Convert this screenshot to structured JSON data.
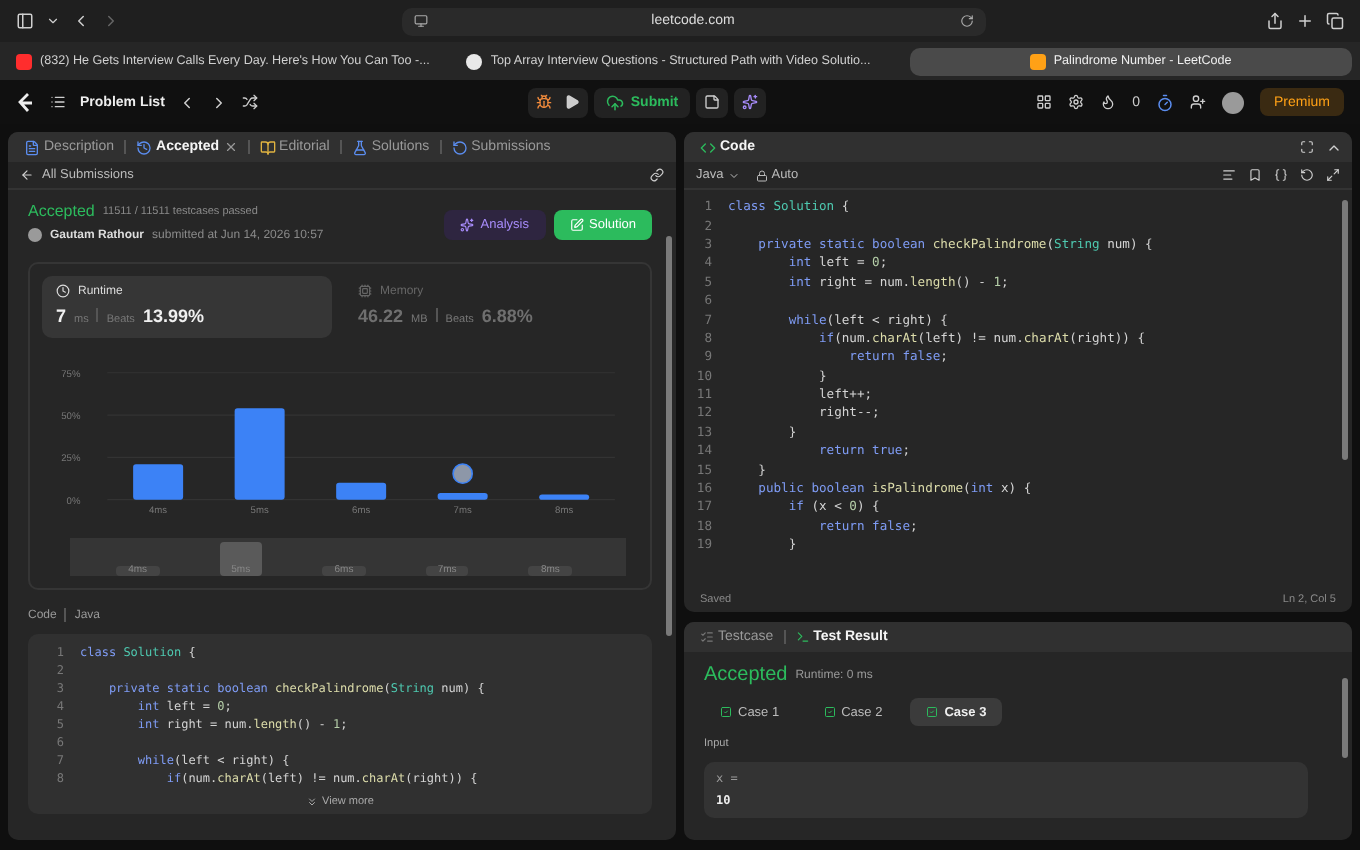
{
  "browser": {
    "url": "leetcode.com",
    "tabs": [
      {
        "title": "(832) He Gets Interview Calls Every Day. Here's How You Can Too -...",
        "selected": false
      },
      {
        "title": "Top Array Interview Questions - Structured Path with Video Solutio...",
        "selected": false
      },
      {
        "title": "Palindrome Number - LeetCode",
        "selected": true
      }
    ]
  },
  "navbar": {
    "problem_list": "Problem List",
    "submit": "Submit",
    "streak": "0",
    "premium": "Premium"
  },
  "description_panel": {
    "tabs": [
      {
        "label": "Description",
        "selected": false,
        "closable": false
      },
      {
        "label": "Accepted",
        "selected": true,
        "closable": true
      },
      {
        "label": "Editorial",
        "selected": false,
        "closable": false
      },
      {
        "label": "Solutions",
        "selected": false,
        "closable": false
      },
      {
        "label": "Submissions",
        "selected": false,
        "closable": false
      }
    ],
    "back_link": "All Submissions",
    "result": {
      "status": "Accepted",
      "testcases": "11511 / 11511 testcases passed",
      "user": "Gautam Rathour",
      "submitted": "submitted at Jun 14, 2026 10:57",
      "analysis": "Analysis",
      "solution": "Solution"
    },
    "stats": [
      {
        "label": "Runtime",
        "value": "7",
        "unit": "ms",
        "beats_label": "Beats",
        "beats": "13.99%",
        "selected": true
      },
      {
        "label": "Memory",
        "value": "46.22",
        "unit": "MB",
        "beats_label": "Beats",
        "beats": "6.88%",
        "selected": false
      }
    ],
    "chart_data": {
      "type": "bar",
      "categories": [
        "4ms",
        "5ms",
        "6ms",
        "7ms",
        "8ms"
      ],
      "series": [
        {
          "color": "#3c82f6",
          "values": [
            21,
            54,
            10,
            4,
            3
          ]
        }
      ],
      "ylim": [
        0,
        75
      ],
      "yticks": [
        {
          "value": 0,
          "label": "0%"
        },
        {
          "value": 25,
          "label": "25%"
        },
        {
          "value": 50,
          "label": "50%"
        },
        {
          "value": 75,
          "label": "75%"
        }
      ]
    },
    "navigator": [
      {
        "label": "4ms",
        "selected": false
      },
      {
        "label": "5ms",
        "selected": true
      },
      {
        "label": "6ms",
        "selected": false
      },
      {
        "label": "7ms",
        "selected": false
      },
      {
        "label": "8ms",
        "selected": false
      }
    ],
    "code": {
      "title": "Code",
      "language": "Java",
      "view_more": "View more",
      "lines": [
        {
          "n": "1",
          "tokens": [
            {
              "text": "class ",
              "kind": "keyword"
            },
            {
              "text": "Solution",
              "kind": "type"
            },
            {
              "text": " {",
              "kind": "plain"
            }
          ]
        },
        {
          "n": "2"
        },
        {
          "n": "3",
          "tokens": [
            {
              "text": "    private static boolean ",
              "kind": "keyword"
            },
            {
              "text": "checkPalindrome",
              "kind": "function"
            },
            {
              "text": "(",
              "kind": "plain"
            },
            {
              "text": "String",
              "kind": "type"
            },
            {
              "text": " num) {",
              "kind": "plain"
            }
          ]
        },
        {
          "n": "4",
          "tokens": [
            {
              "text": "        int ",
              "kind": "keyword"
            },
            {
              "text": "left = ",
              "kind": "plain"
            },
            {
              "text": "0",
              "kind": "number"
            },
            {
              "text": ";",
              "kind": "plain"
            }
          ]
        },
        {
          "n": "5",
          "tokens": [
            {
              "text": "        int ",
              "kind": "keyword"
            },
            {
              "text": "right = num.",
              "kind": "plain"
            },
            {
              "text": "length",
              "kind": "function"
            },
            {
              "text": "() - ",
              "kind": "plain"
            },
            {
              "text": "1",
              "kind": "number"
            },
            {
              "text": ";",
              "kind": "plain"
            }
          ]
        },
        {
          "n": "6"
        },
        {
          "n": "7",
          "tokens": [
            {
              "text": "        while",
              "kind": "keyword"
            },
            {
              "text": "(left < right) {",
              "kind": "plain"
            }
          ]
        },
        {
          "n": "8",
          "tokens": [
            {
              "text": "            if",
              "kind": "keyword"
            },
            {
              "text": "(num.",
              "kind": "plain"
            },
            {
              "text": "charAt",
              "kind": "function"
            },
            {
              "text": "(left) != num.",
              "kind": "plain"
            },
            {
              "text": "charAt",
              "kind": "function"
            },
            {
              "text": "(right)) {",
              "kind": "plain"
            }
          ]
        }
      ]
    }
  },
  "editor": {
    "title": "Code",
    "language": "Java",
    "mode": "Auto",
    "status": "Saved",
    "cursor": "Ln 2, Col 5",
    "lines": [
      {
        "n": "1",
        "tokens": [
          {
            "text": "class ",
            "kind": "keyword"
          },
          {
            "text": "Solution",
            "kind": "type"
          },
          {
            "text": " {",
            "kind": "plain"
          }
        ]
      },
      {
        "n": "2"
      },
      {
        "n": "3",
        "tokens": [
          {
            "text": "    private static boolean ",
            "kind": "keyword"
          },
          {
            "text": "checkPalindrome",
            "kind": "function"
          },
          {
            "text": "(",
            "kind": "plain"
          },
          {
            "text": "String",
            "kind": "type"
          },
          {
            "text": " num) {",
            "kind": "plain"
          }
        ]
      },
      {
        "n": "4",
        "tokens": [
          {
            "text": "        int ",
            "kind": "keyword"
          },
          {
            "text": "left = ",
            "kind": "plain"
          },
          {
            "text": "0",
            "kind": "number"
          },
          {
            "text": ";",
            "kind": "plain"
          }
        ]
      },
      {
        "n": "5",
        "tokens": [
          {
            "text": "        int ",
            "kind": "keyword"
          },
          {
            "text": "right = num.",
            "kind": "plain"
          },
          {
            "text": "length",
            "kind": "function"
          },
          {
            "text": "() - ",
            "kind": "plain"
          },
          {
            "text": "1",
            "kind": "number"
          },
          {
            "text": ";",
            "kind": "plain"
          }
        ]
      },
      {
        "n": "6"
      },
      {
        "n": "7",
        "tokens": [
          {
            "text": "        while",
            "kind": "keyword"
          },
          {
            "text": "(left < right) {",
            "kind": "plain"
          }
        ]
      },
      {
        "n": "8",
        "tokens": [
          {
            "text": "            if",
            "kind": "keyword"
          },
          {
            "text": "(num.",
            "kind": "plain"
          },
          {
            "text": "charAt",
            "kind": "function"
          },
          {
            "text": "(left) != num.",
            "kind": "plain"
          },
          {
            "text": "charAt",
            "kind": "function"
          },
          {
            "text": "(right)) {",
            "kind": "plain"
          }
        ]
      },
      {
        "n": "9",
        "tokens": [
          {
            "text": "                return false",
            "kind": "keyword"
          },
          {
            "text": ";",
            "kind": "plain"
          }
        ]
      },
      {
        "n": "10",
        "tokens": [
          {
            "text": "            }",
            "kind": "plain"
          }
        ]
      },
      {
        "n": "11",
        "tokens": [
          {
            "text": "            left++;",
            "kind": "plain"
          }
        ]
      },
      {
        "n": "12",
        "tokens": [
          {
            "text": "            right--;",
            "kind": "plain"
          }
        ]
      },
      {
        "n": "13",
        "tokens": [
          {
            "text": "        }",
            "kind": "plain"
          }
        ]
      },
      {
        "n": "14",
        "tokens": [
          {
            "text": "            return true",
            "kind": "keyword"
          },
          {
            "text": ";",
            "kind": "plain"
          }
        ]
      },
      {
        "n": "15",
        "tokens": [
          {
            "text": "    }",
            "kind": "plain"
          }
        ]
      },
      {
        "n": "16",
        "tokens": [
          {
            "text": "    public boolean ",
            "kind": "keyword"
          },
          {
            "text": "isPalindrome",
            "kind": "function"
          },
          {
            "text": "(",
            "kind": "plain"
          },
          {
            "text": "int",
            "kind": "keyword"
          },
          {
            "text": " x) {",
            "kind": "plain"
          }
        ]
      },
      {
        "n": "17",
        "tokens": [
          {
            "text": "        if",
            "kind": "keyword"
          },
          {
            "text": " (x < ",
            "kind": "plain"
          },
          {
            "text": "0",
            "kind": "number"
          },
          {
            "text": ") {",
            "kind": "plain"
          }
        ]
      },
      {
        "n": "18",
        "tokens": [
          {
            "text": "            return false",
            "kind": "keyword"
          },
          {
            "text": ";",
            "kind": "plain"
          }
        ]
      },
      {
        "n": "19",
        "tokens": [
          {
            "text": "        }",
            "kind": "plain"
          }
        ]
      }
    ]
  },
  "test_panel": {
    "tabs": [
      {
        "label": "Testcase",
        "selected": false
      },
      {
        "label": "Test Result",
        "selected": true
      }
    ],
    "status": "Accepted",
    "runtime": "Runtime: 0 ms",
    "cases": [
      {
        "label": "Case 1",
        "selected": false
      },
      {
        "label": "Case 2",
        "selected": false
      },
      {
        "label": "Case 3",
        "selected": true
      }
    ],
    "input_label": "Input",
    "input_name": "x =",
    "input_value": "10"
  }
}
